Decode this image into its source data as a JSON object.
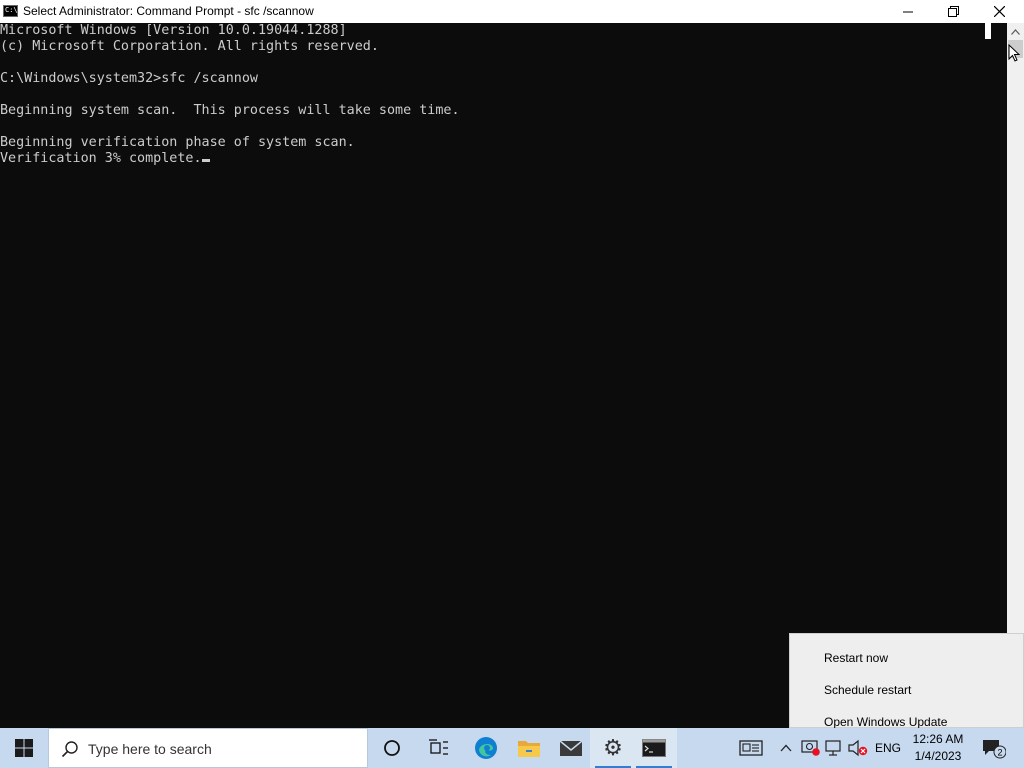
{
  "window": {
    "title": "Select Administrator: Command Prompt - sfc  /scannow",
    "minimize_glyph": "—",
    "restore_glyph": "❐",
    "close_glyph": "✕"
  },
  "console": {
    "lines": [
      "Microsoft Windows [Version 10.0.19044.1288]",
      "(c) Microsoft Corporation. All rights reserved.",
      "",
      "C:\\Windows\\system32>sfc /scannow",
      "",
      "Beginning system scan.  This process will take some time.",
      "",
      "Beginning verification phase of system scan.",
      "Verification 3% complete."
    ],
    "progress_percent": 3
  },
  "context_menu": {
    "items": [
      "Restart now",
      "Schedule restart",
      "Open Windows Update"
    ]
  },
  "taskbar": {
    "search_placeholder": "Type here to search",
    "language": "ENG",
    "time": "12:26 AM",
    "date": "1/4/2023",
    "notification_count": "2",
    "accent_color": "#2f7fd6",
    "pinned_apps": [
      "cortana-icon",
      "task-view-icon",
      "edge-icon",
      "file-explorer-icon",
      "mail-icon",
      "settings-icon",
      "command-prompt-icon"
    ]
  }
}
